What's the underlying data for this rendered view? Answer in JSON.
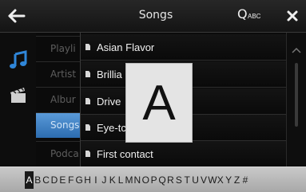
{
  "header": {
    "title": "Songs",
    "search_q": "Q",
    "search_abc": "ABC"
  },
  "categories": [
    {
      "label": "Playli",
      "active": false
    },
    {
      "label": "Artist",
      "active": false
    },
    {
      "label": "Albur",
      "active": false
    },
    {
      "label": "Songs",
      "active": true
    },
    {
      "label": "Podca",
      "active": false
    }
  ],
  "songs": [
    {
      "title": "Asian Flavor"
    },
    {
      "title": "Brillia"
    },
    {
      "title": "Drive"
    },
    {
      "title": "Eye-tc"
    },
    {
      "title": "First contact"
    }
  ],
  "popup_letter": "A",
  "alphabet": [
    "A",
    "B",
    "C",
    "D",
    "E",
    "F",
    "G",
    "H",
    "I",
    "J",
    "K",
    "L",
    "M",
    "N",
    "O",
    "P",
    "Q",
    "R",
    "S",
    "T",
    "U",
    "V",
    "W",
    "X",
    "Y",
    "Z",
    "#"
  ],
  "selected_letter": "A",
  "colors": {
    "accent_blue": "#3a7fc4",
    "music_icon": "#2f86d9"
  }
}
